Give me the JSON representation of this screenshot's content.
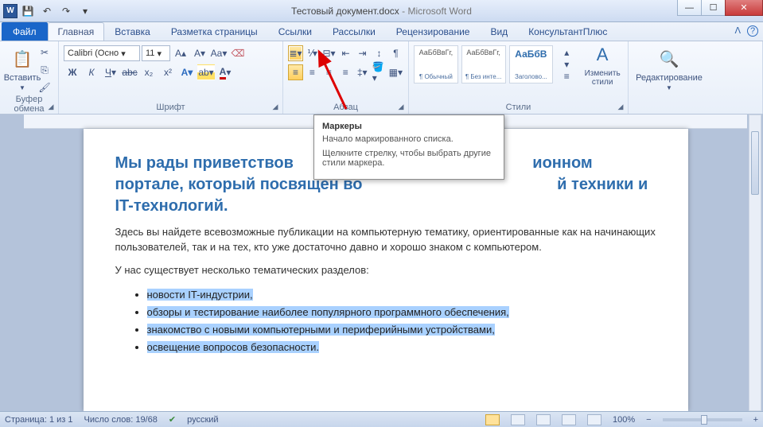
{
  "title": {
    "doc": "Тестовый документ.docx",
    "app": "Microsoft Word"
  },
  "qat": {
    "word": "W"
  },
  "tabs": {
    "file": "Файл",
    "items": [
      "Главная",
      "Вставка",
      "Разметка страницы",
      "Ссылки",
      "Рассылки",
      "Рецензирование",
      "Вид",
      "КонсультантПлюс"
    ],
    "active_index": 0
  },
  "ribbon": {
    "clipboard": {
      "paste": "Вставить",
      "label": "Буфер обмена"
    },
    "font": {
      "name": "Calibri (Осно",
      "size": "11",
      "label": "Шрифт"
    },
    "paragraph": {
      "label": "Абзац"
    },
    "styles": {
      "label": "Стили",
      "items": [
        {
          "sample": "АаБбВвГг,",
          "name": "¶ Обычный"
        },
        {
          "sample": "АаБбВвГг,",
          "name": "¶ Без инте..."
        },
        {
          "sample": "АаБбВ",
          "name": "Заголово..."
        }
      ],
      "change": "Изменить стили"
    },
    "editing": {
      "label": "Редактирование"
    }
  },
  "tooltip": {
    "title": "Маркеры",
    "line1": "Начало маркированного списка.",
    "line2": "Щелкните стрелку, чтобы выбрать другие стили маркера."
  },
  "document": {
    "heading_parts": [
      "Мы рады приветствов",
      "ионном портале, который посвящен во",
      "й техники и IT-технологий."
    ],
    "para1": "Здесь вы найдете всевозможные публикации на компьютерную тематику, ориентированные как на начинающих пользователей, так и на тех, кто уже достаточно давно и хорошо знаком с компьютером.",
    "para2": "У нас существует несколько тематических разделов:",
    "list": [
      "новости IT-индустрии,",
      "обзоры и тестирование наиболее популярного программного обеспечения,",
      "знакомство с новыми компьютерными и периферийными устройствами,",
      "освещение вопросов безопасности."
    ]
  },
  "status": {
    "page": "Страница: 1 из 1",
    "words": "Число слов: 19/68",
    "lang": "русский",
    "zoom": "100%"
  }
}
